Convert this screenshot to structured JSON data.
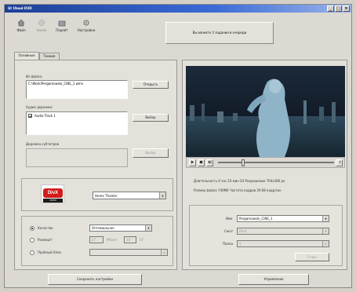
{
  "window": {
    "title": "Gt Ulead DVD",
    "min": "_",
    "max": "□",
    "close": "×"
  },
  "toolbar": {
    "items": [
      {
        "label": "Файл",
        "disabled": false
      },
      {
        "label": "Новое",
        "disabled": true
      },
      {
        "label": "Перейт",
        "disabled": false
      },
      {
        "label": "Настройки",
        "disabled": false
      }
    ]
  },
  "status_banner": "Вы можете 2 задания в очереди",
  "tabs": [
    {
      "label": "Основные"
    },
    {
      "label": "Тонкие"
    }
  ],
  "source": {
    "label": "Из файла:",
    "path": "C:\\Work\\Pergamowski_CiNE_1.wmv",
    "button": "Открыть"
  },
  "audio": {
    "label": "Аудио дорожки:",
    "track": "Audio Track 1",
    "button": "Выбор"
  },
  "subtitle": {
    "label": "Дорожка субтитров",
    "button": "Выбор"
  },
  "codec": {
    "logo_main": "DivX",
    "logo_sub": "VIDEO",
    "profile": "Home Theater"
  },
  "quality": {
    "opt1_label": "Качество",
    "opt1_value": "Оптимальное",
    "opt2_label": "Размер/т",
    "opt2_a": "27",
    "opt2_unit": "Мбайт",
    "opt2_b": "10",
    "opt2_c": "07",
    "opt3_label": "Пробный блок"
  },
  "info": {
    "line1": "Длительность    0 час 10 мин 03    Разрешение    704x396 px",
    "line2": "Размер файла    749Mб    Частота кадров    29.68 кадр/сек"
  },
  "output": {
    "label1": "Имя",
    "value1": "Pergamowski_CiNE_1",
    "label2": "Сжат",
    "value2": "DivX",
    "label3": "Папка",
    "value3": "5",
    "button": "Старт"
  },
  "footer": {
    "save_label": "Сохранить настройки",
    "run_label": "Управление"
  },
  "colors": {
    "accent": "#2a4fb0",
    "bg": "#dcd9d2"
  }
}
